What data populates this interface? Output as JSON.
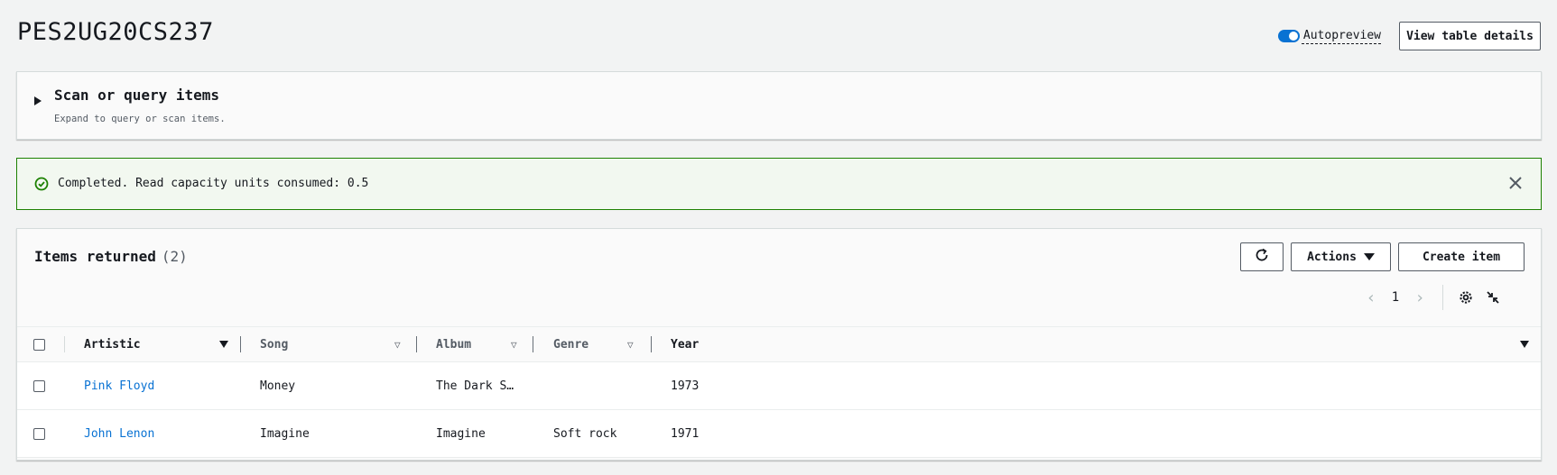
{
  "header": {
    "title": "PES2UG20CS237",
    "autopreview_label": "Autopreview",
    "view_details_label": "View table details"
  },
  "expander": {
    "title": "Scan or query items",
    "description": "Expand to query or scan items."
  },
  "flash": {
    "message": "Completed. Read capacity units consumed: 0.5"
  },
  "items": {
    "heading": "Items returned",
    "count": "(2)",
    "actions_label": "Actions",
    "create_label": "Create item",
    "page": "1",
    "columns": [
      "Artistic",
      "Song",
      "Album",
      "Genre",
      "Year"
    ],
    "rows": [
      {
        "artistic": "Pink Floyd",
        "song": "Money",
        "album": "The Dark S…",
        "genre": "",
        "year": "1973"
      },
      {
        "artistic": "John Lenon",
        "song": "Imagine",
        "album": "Imagine",
        "genre": "Soft rock",
        "year": "1971"
      }
    ]
  },
  "colors": {
    "accent": "#0972d3",
    "success": "#1d8102"
  }
}
